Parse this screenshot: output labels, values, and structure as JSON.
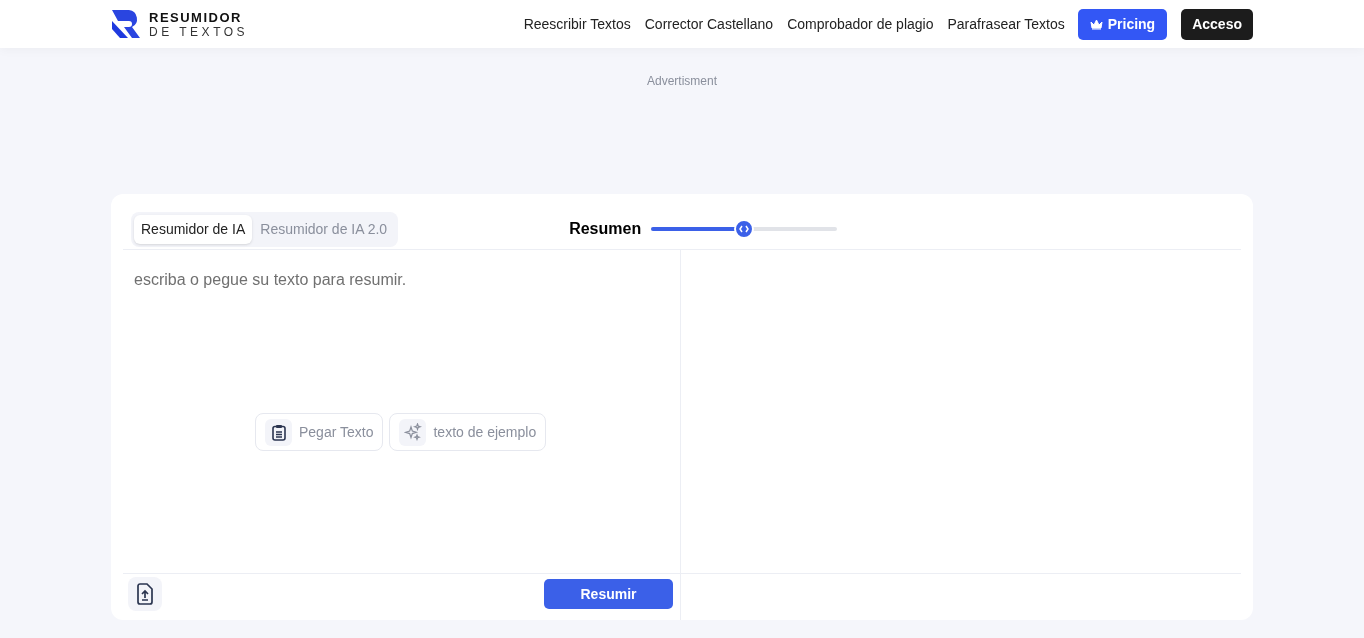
{
  "logo": {
    "line_1": "RESUMIDOR",
    "line_2": "DE TEXTOS"
  },
  "nav": {
    "links": [
      "Reescribir Textos",
      "Corrector Castellano",
      "Comprobador de plagio",
      "Parafrasear Textos"
    ],
    "pricing": "Pricing",
    "login": "Acceso"
  },
  "ad_label": "Advertisment",
  "tabs": [
    {
      "label": "Resumidor de IA",
      "selected": true
    },
    {
      "label": "Resumidor de IA 2.0",
      "selected": false
    }
  ],
  "summary_length": {
    "label": "Resumen",
    "level": 0.5
  },
  "editor": {
    "placeholder": "escriba o pegue su texto para resumir.",
    "actions": [
      {
        "kind": "paste",
        "label": "Pegar Texto"
      },
      {
        "kind": "sample",
        "label": "texto de ejemplo"
      }
    ],
    "submit": "Resumir"
  }
}
